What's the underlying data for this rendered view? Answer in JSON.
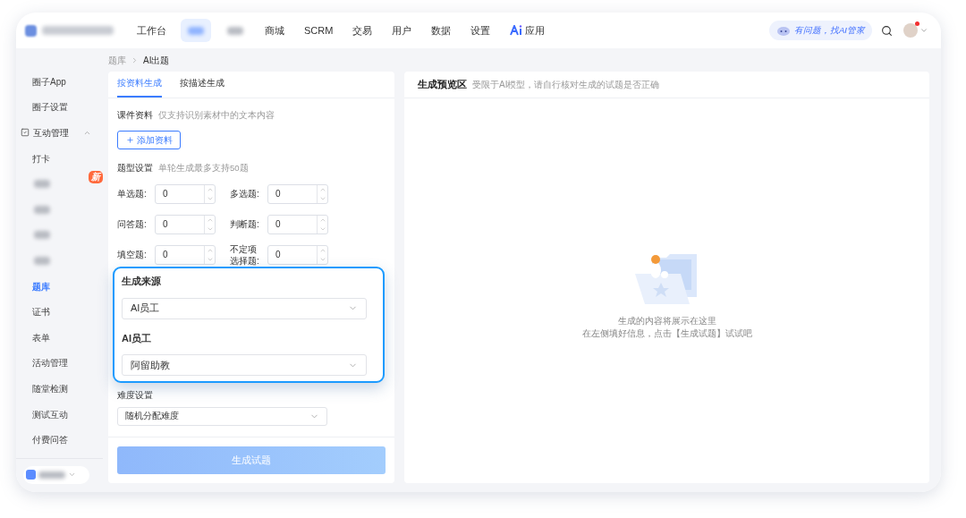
{
  "nav": {
    "items": [
      {
        "kind": "text",
        "label": "工作台",
        "selected": false
      },
      {
        "kind": "blurred",
        "selected": true
      },
      {
        "kind": "blurred",
        "selected": false
      },
      {
        "kind": "text",
        "label": "商城",
        "selected": false
      },
      {
        "kind": "text",
        "label": "SCRM",
        "selected": false
      },
      {
        "kind": "text",
        "label": "交易",
        "selected": false
      },
      {
        "kind": "text",
        "label": "用户",
        "selected": false
      },
      {
        "kind": "text",
        "label": "数据",
        "selected": false
      },
      {
        "kind": "text",
        "label": "设置",
        "selected": false
      },
      {
        "kind": "ai",
        "label": "应用",
        "selected": false
      }
    ],
    "assistant": "有问题，找AI管家",
    "notification": true
  },
  "sidebar": {
    "items": [
      {
        "kind": "text",
        "label": "圈子App",
        "selected": false
      },
      {
        "kind": "text",
        "label": "圈子设置",
        "selected": false
      },
      {
        "kind": "group",
        "label": "互动管理",
        "expanded": true,
        "children": [
          {
            "kind": "text",
            "label": "打卡",
            "selected": false
          },
          {
            "kind": "blurred",
            "badge": "新",
            "selected": false
          },
          {
            "kind": "blurred",
            "selected": false
          },
          {
            "kind": "blurred",
            "selected": false
          },
          {
            "kind": "blurred",
            "selected": false
          },
          {
            "kind": "text",
            "label": "题库",
            "selected": true
          },
          {
            "kind": "text",
            "label": "证书",
            "selected": false
          },
          {
            "kind": "text",
            "label": "表单",
            "selected": false
          },
          {
            "kind": "text",
            "label": "活动管理",
            "selected": false
          },
          {
            "kind": "text",
            "label": "随堂检测",
            "selected": false
          },
          {
            "kind": "text",
            "label": "测试互动",
            "selected": false
          },
          {
            "kind": "text",
            "label": "付费问答",
            "selected": false
          }
        ]
      }
    ]
  },
  "breadcrumb": [
    "题库",
    "AI出题"
  ],
  "form": {
    "tabs": [
      {
        "label": "按资料生成",
        "selected": true
      },
      {
        "label": "按描述生成",
        "selected": false
      }
    ],
    "material": {
      "label": "课件资料",
      "hint": "仅支持识别素材中的文本内容",
      "button": "添加资料"
    },
    "types": {
      "label": "题型设置",
      "hint": "单轮生成最多支持50题",
      "fields": [
        {
          "label": "单选题:",
          "value": "0"
        },
        {
          "label": "多选题:",
          "value": "0"
        },
        {
          "label": "问答题:",
          "value": "0"
        },
        {
          "label": "判断题:",
          "value": "0"
        },
        {
          "label": "填空题:",
          "value": "0"
        },
        {
          "label": "不定项选择题:",
          "value": "0"
        }
      ]
    },
    "source": {
      "label": "生成来源",
      "value": "AI员工"
    },
    "employee": {
      "label": "AI员工",
      "value": "阿留助教"
    },
    "difficulty": {
      "label": "难度设置",
      "value": "随机分配难度"
    },
    "submit": {
      "label": "生成试题",
      "disabled": true
    }
  },
  "preview": {
    "title": "生成预览区",
    "hint": "受限于AI模型，请自行核对生成的试题是否正确",
    "empty": [
      "生成的内容将展示在这里",
      "在左侧填好信息，点击【生成试题】试试吧"
    ]
  }
}
